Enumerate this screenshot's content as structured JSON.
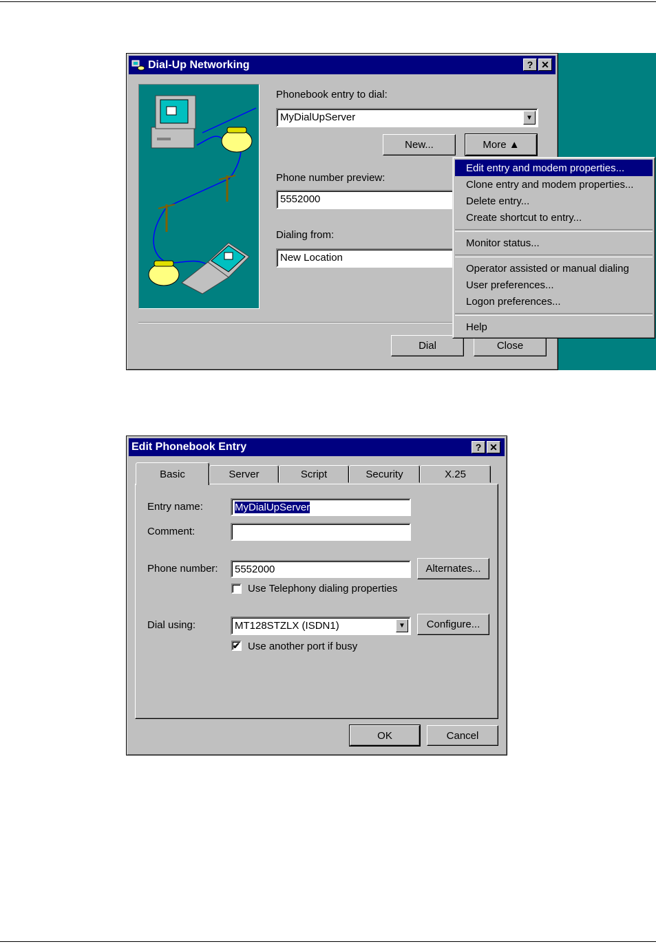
{
  "dialup": {
    "title": "Dial-Up Networking",
    "help_btn": "?",
    "close_btn": "✕",
    "phonebook_label": "Phonebook entry to dial:",
    "phonebook_value": "MyDialUpServer",
    "new_button": "New...",
    "more_button": "More ▲",
    "phone_preview_label": "Phone number preview:",
    "phone_preview_value": "5552000",
    "dialing_from_label": "Dialing from:",
    "dialing_from_value": "New Location",
    "dial_button": "Dial",
    "close_button": "Close"
  },
  "more_menu": {
    "items": [
      "Edit entry and modem properties...",
      "Clone entry and modem properties...",
      "Delete entry...",
      "Create shortcut to entry...",
      "Monitor status...",
      "Operator assisted or manual dialing",
      "User preferences...",
      "Logon preferences...",
      "Help"
    ]
  },
  "edit_entry": {
    "title": "Edit Phonebook Entry",
    "help_btn": "?",
    "close_btn": "✕",
    "tabs": [
      "Basic",
      "Server",
      "Script",
      "Security",
      "X.25"
    ],
    "entry_name_label": "Entry name:",
    "entry_name_value": "MyDialUpServer",
    "comment_label": "Comment:",
    "comment_value": "",
    "phone_number_label": "Phone number:",
    "phone_number_value": "5552000",
    "alternates_button": "Alternates...",
    "telephony_checkbox_label": "Use Telephony dialing properties",
    "telephony_checked": false,
    "dial_using_label": "Dial using:",
    "dial_using_value": "MT128STZLX (ISDN1)",
    "configure_button": "Configure...",
    "another_port_label": "Use another port if busy",
    "another_port_checked": true,
    "ok_button": "OK",
    "cancel_button": "Cancel"
  },
  "colors": {
    "title_bar": "#000080",
    "window_face": "#c0c0c0",
    "desktop": "#008080",
    "illustration_bg": "#008080",
    "menu_highlight": "#000080"
  }
}
